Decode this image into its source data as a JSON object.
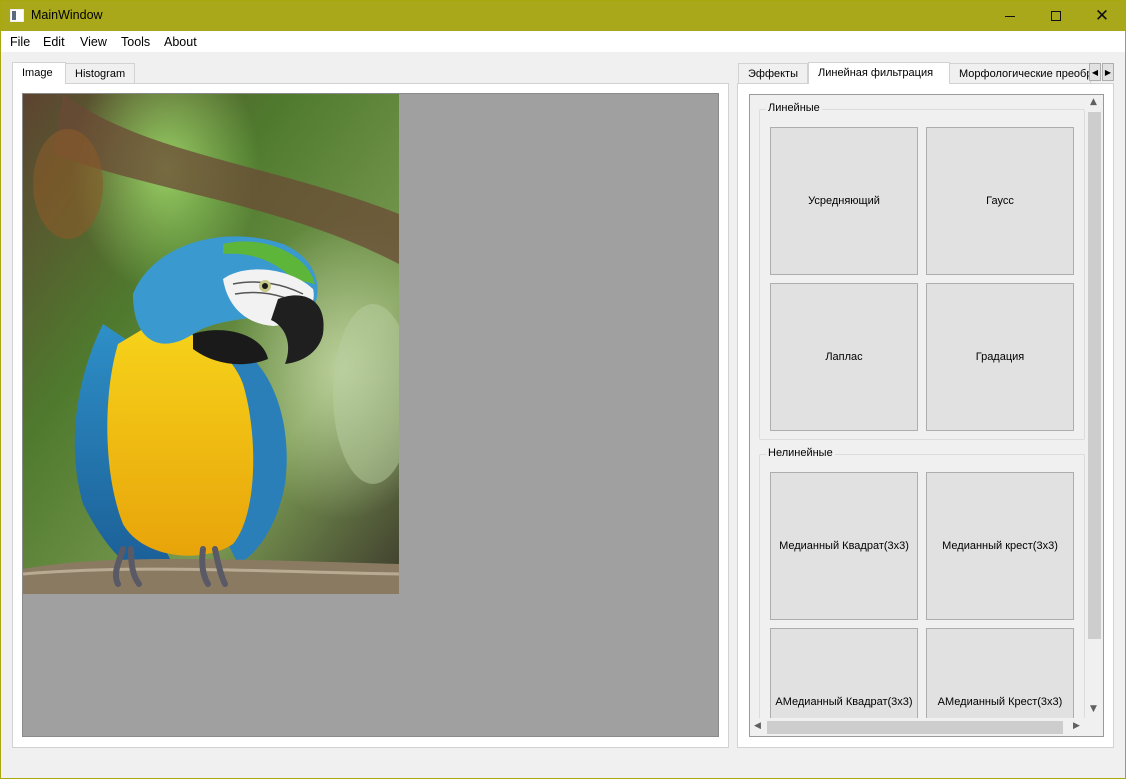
{
  "window": {
    "title": "MainWindow"
  },
  "menu": [
    "File",
    "Edit",
    "View",
    "Tools",
    "About"
  ],
  "left_panel": {
    "tabs": [
      "Image",
      "Histogram"
    ],
    "active_tab": "Image",
    "image": "parrot-photo"
  },
  "right_panel": {
    "tabs": [
      "Эффекты",
      "Линейная фильтрация",
      "Морфологические преобразования"
    ],
    "active_tab": "Линейная фильтрация",
    "groups": [
      {
        "title": "Линейные",
        "buttons": [
          "Усредняющий",
          "Гаусс",
          "Лаплас",
          "Градация"
        ]
      },
      {
        "title": "Нелинейные",
        "buttons": [
          "Медианный Квадрат(3x3)",
          "Медианный крест(3x3)",
          "АМедианный Квадрат(3x3)",
          "АМедианный Крест(3x3)"
        ]
      }
    ]
  },
  "icons": {
    "app": "app-window-icon",
    "minimize": "minimize-icon",
    "maximize": "maximize-icon",
    "close": "close-icon"
  },
  "colors": {
    "titlebar": "#a8a81a",
    "image_background": "#a0a0a0",
    "button_face": "#e1e1e1"
  }
}
